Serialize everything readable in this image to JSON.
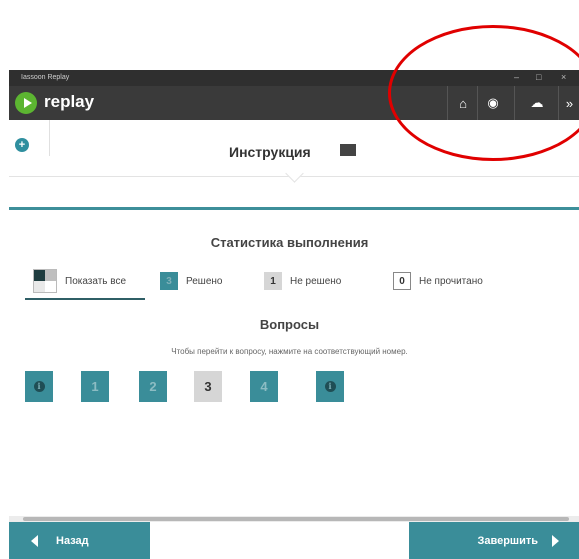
{
  "window": {
    "title": "Iassoon Replay",
    "minimize": "–",
    "maximize": "□",
    "close": "×"
  },
  "header": {
    "brand": "replay",
    "buttons": [
      {
        "icon": "home-icon",
        "glyph": "⌂"
      },
      {
        "icon": "globe-icon",
        "glyph": "◉"
      },
      {
        "icon": "cloud-icon",
        "glyph": "☁"
      },
      {
        "icon": "double-chevron-right-icon",
        "glyph": "»"
      }
    ]
  },
  "instruction": {
    "title": "Инструкция"
  },
  "stats": {
    "title": "Статистика выполнения",
    "legend": [
      {
        "key": "all",
        "label": "Показать все"
      },
      {
        "key": "solved",
        "count": "3",
        "label": "Решено"
      },
      {
        "key": "unsolved",
        "count": "1",
        "label": "Не решено"
      },
      {
        "key": "unread",
        "count": "0",
        "label": "Не прочитано"
      }
    ]
  },
  "questions": {
    "title": "Вопросы",
    "hint": "Чтобы перейти к вопросу, нажмите на соответствующий номер.",
    "items": [
      {
        "label": "i",
        "state": "info"
      },
      {
        "label": "1",
        "state": "solved"
      },
      {
        "label": "2",
        "state": "solved"
      },
      {
        "label": "3",
        "state": "unsolved"
      },
      {
        "label": "4",
        "state": "solved"
      },
      {
        "label": "i",
        "state": "info"
      }
    ]
  },
  "footer": {
    "back_label": "Назад",
    "finish_label": "Завершить"
  },
  "colors": {
    "accent": "#3a8d99",
    "header": "#3a3a3a",
    "annotation": "#e00000"
  }
}
